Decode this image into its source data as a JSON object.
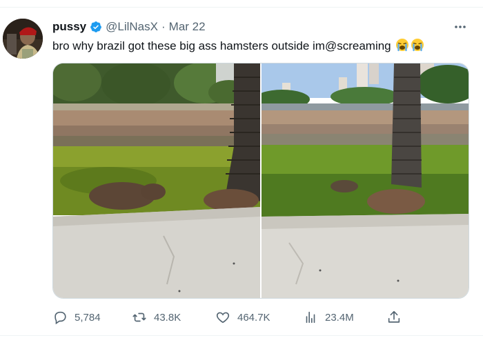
{
  "tweet": {
    "display_name": "pussy",
    "handle": "@LilNasX",
    "separator": "·",
    "date": "Mar 22",
    "text": "bro why brazil got these big ass hamsters outside im@screaming",
    "emoji_icons": [
      "loudly-crying-face-icon",
      "loudly-crying-face-icon"
    ]
  },
  "metrics": {
    "replies": "5,784",
    "retweets": "43.8K",
    "likes": "464.7K",
    "views": "23.4M"
  },
  "colors": {
    "verified": "#1d9bf0",
    "secondary_text": "#536471",
    "primary_text": "#0f1419",
    "border": "#cfd9de"
  },
  "icons": {
    "verified": "verified-badge-icon",
    "more": "more-dots-icon",
    "reply": "reply-icon",
    "retweet": "retweet-icon",
    "like": "heart-icon",
    "views": "views-chart-icon",
    "share": "share-icon"
  }
}
